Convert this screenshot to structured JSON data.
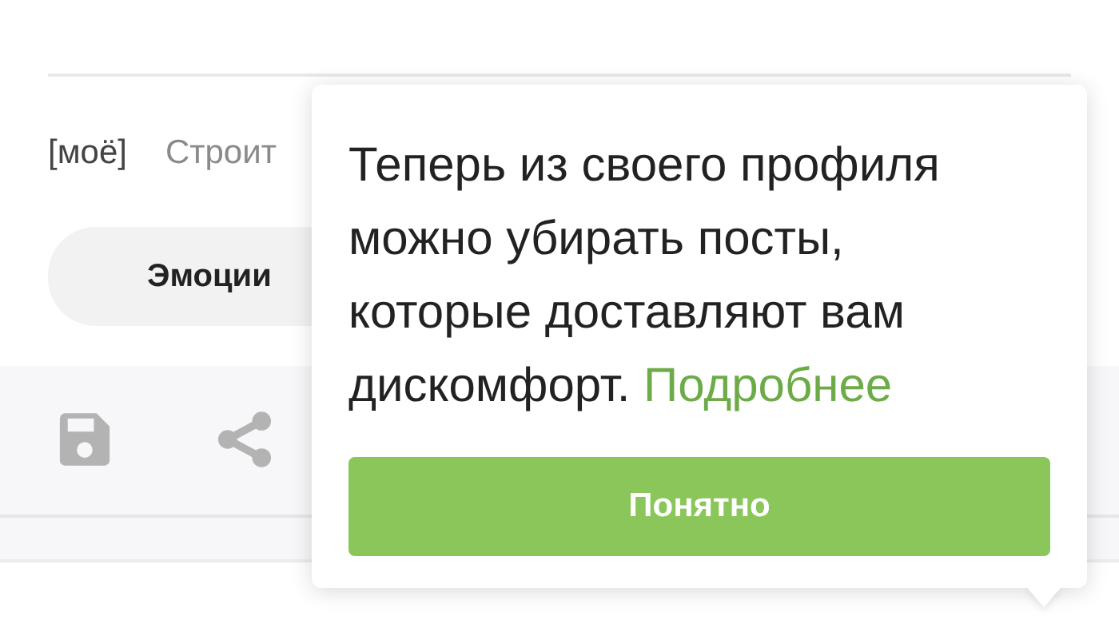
{
  "tags": [
    {
      "label": "[моё]",
      "kind": "own"
    },
    {
      "label": "Строит",
      "kind": "community"
    }
  ],
  "tabs": [
    {
      "label": "Эмоции",
      "selected": true
    }
  ],
  "actions": [
    {
      "kind": "save"
    },
    {
      "kind": "share"
    }
  ],
  "popover": {
    "text": "Теперь из своего профиля можно убирать посты, которые доставляют вам дискомфорт.",
    "link": "Подробнее",
    "button": "Понятно"
  }
}
